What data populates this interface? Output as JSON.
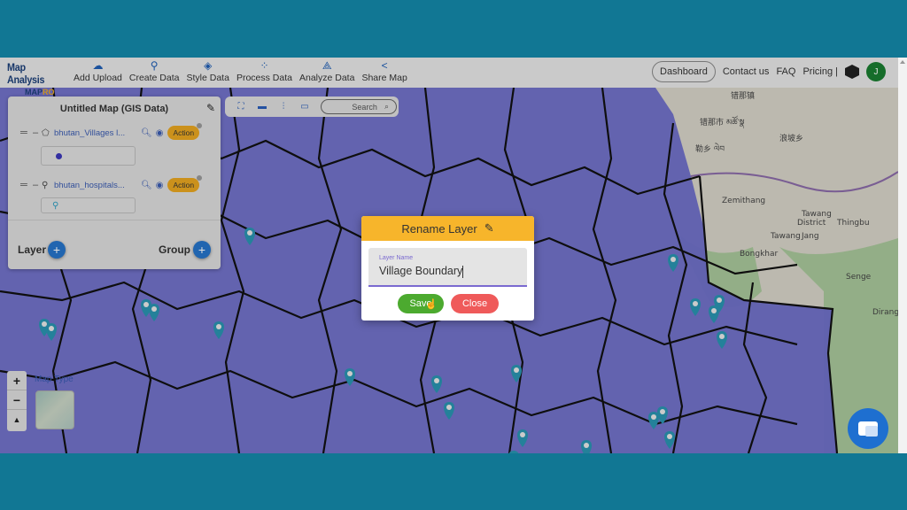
{
  "brand": {
    "title": "Map Analysis",
    "subtitle_a": "MAP",
    "subtitle_b": "RO"
  },
  "nav": [
    {
      "icon": "cloud-upload-icon",
      "glyph": "☁",
      "label": "Add Upload"
    },
    {
      "icon": "location-pin-icon",
      "glyph": "⚲",
      "label": "Create Data"
    },
    {
      "icon": "paint-bucket-icon",
      "glyph": "◈",
      "label": "Style Data"
    },
    {
      "icon": "process-icon",
      "glyph": "⁘",
      "label": "Process Data"
    },
    {
      "icon": "analyze-icon",
      "glyph": "⟁",
      "label": "Analyze Data"
    },
    {
      "icon": "share-icon",
      "glyph": "<",
      "label": "Share Map"
    }
  ],
  "right_nav": {
    "dashboard": "Dashboard",
    "contact": "Contact us",
    "faq": "FAQ",
    "pricing": "Pricing |",
    "avatar_initial": "J"
  },
  "panel": {
    "title": "Untitled Map (GIS Data)",
    "layers": [
      {
        "name": "bhutan_Villages l...",
        "type_icon": "polygon-icon",
        "action": "Action",
        "legend": "point-dot"
      },
      {
        "name": "bhutan_hospitals...",
        "type_icon": "pin-icon",
        "action": "Action",
        "legend": "pin"
      }
    ],
    "layer_label": "Layer",
    "group_label": "Group"
  },
  "toolbar": {
    "search_label": "Search"
  },
  "map_controls": {
    "zoom_in": "+",
    "zoom_out": "−",
    "reset": "▲",
    "map_type_label": "Map Type"
  },
  "map_labels": [
    {
      "text": "错那镇"
    },
    {
      "text": "错那市 མཚོ་སྣ"
    },
    {
      "text": "浪坡乡"
    },
    {
      "text": "勒乡 ལེབ"
    },
    {
      "text": "Zemithang"
    },
    {
      "text": "Tawang"
    },
    {
      "text": "District"
    },
    {
      "text": "Thingbu"
    },
    {
      "text": "Tawang"
    },
    {
      "text": "Jang"
    },
    {
      "text": "Bongkhar"
    },
    {
      "text": "Senge"
    },
    {
      "text": "Dirang"
    }
  ],
  "modal": {
    "title": "Rename Layer",
    "field_label": "Layer Name",
    "field_value": "Village Boundary",
    "save": "Save",
    "close": "Close"
  },
  "colors": {
    "frame_bg": "#117794",
    "layer_fill": "#6c6cc8",
    "modal_header": "#f7b52b",
    "save": "#4caa2f",
    "close": "#ef5a5a",
    "marker": "#2a93b0"
  }
}
